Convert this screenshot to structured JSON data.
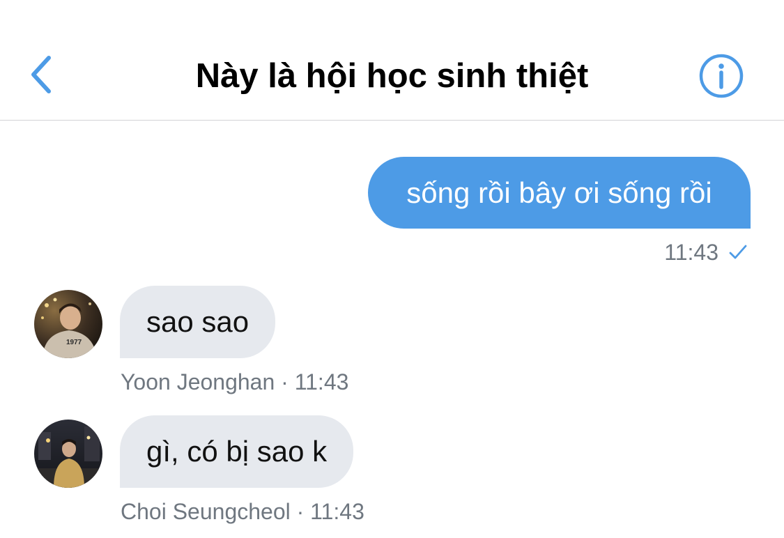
{
  "header": {
    "title": "Này là hội học sinh thiệt",
    "back_icon": "chevron-left-icon",
    "info_icon": "info-circle-icon",
    "accent_color": "#4d9be6"
  },
  "messages": [
    {
      "direction": "outgoing",
      "text": "sống rồi bây ơi sống rồi",
      "time": "11:43",
      "status_icon": "check-icon"
    },
    {
      "direction": "incoming",
      "text": "sao sao",
      "sender": "Yoon Jeonghan",
      "separator": "·",
      "time": "11:43",
      "avatar_text": "1977"
    },
    {
      "direction": "incoming",
      "text": "gì, có bị sao k",
      "sender": "Choi Seungcheol",
      "separator": "·",
      "time": "11:43"
    }
  ],
  "colors": {
    "outgoing_bubble": "#4d9be6",
    "incoming_bubble": "#e6e9ee",
    "meta_text": "#6f7780"
  }
}
